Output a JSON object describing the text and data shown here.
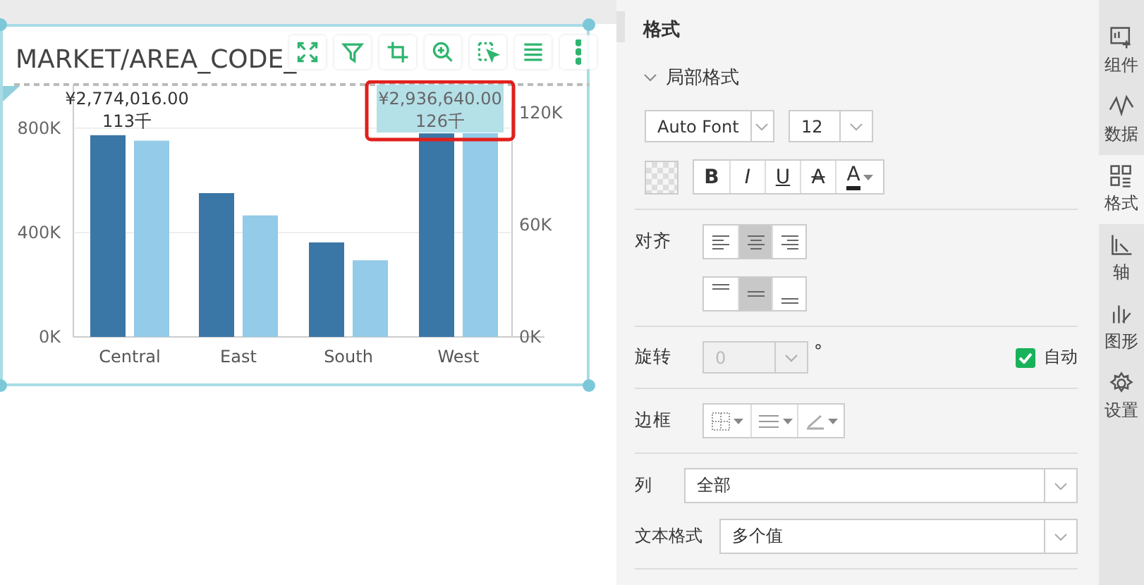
{
  "chart_card": {
    "title": "MARKET/AREA_CODE_",
    "bar_labels": [
      {
        "kind": "first",
        "lines": [
          "¥2,774,016.00",
          "113千"
        ],
        "highlighted": false
      },
      {
        "kind": "last",
        "lines": [
          "¥2,936,640.00",
          "126千"
        ],
        "highlighted": true
      }
    ],
    "chart_data": {
      "type": "bar",
      "stacked": false,
      "categories": [
        "Central",
        "East",
        "South",
        "West"
      ],
      "series": [
        {
          "color": "#3a76a6",
          "values": [
            773000,
            551000,
            362000,
            780000
          ]
        },
        {
          "color": "#93cbe8",
          "axis": "y2",
          "values": [
            105000,
            65000,
            41000,
            109000
          ]
        }
      ],
      "ylim": [
        0,
        967000
      ],
      "y2lim": [
        0,
        135000
      ],
      "yticks": [
        {
          "value": 0,
          "label": "0K"
        },
        {
          "value": 400000,
          "label": "400K"
        },
        {
          "value": 800000,
          "label": "800K"
        }
      ],
      "y2ticks": [
        {
          "value": 0,
          "label": "0K"
        },
        {
          "value": 60000,
          "label": "60K"
        },
        {
          "value": 120000,
          "label": "120K"
        }
      ]
    }
  },
  "panel": {
    "title": "格式",
    "section": {
      "label": "局部格式",
      "expanded": true
    },
    "font": {
      "family": "Auto Font",
      "size": "12"
    },
    "style_buttons": [
      {
        "label": "B",
        "kind": "bold"
      },
      {
        "label": "I",
        "kind": "italic"
      },
      {
        "label": "U",
        "kind": "underline"
      },
      {
        "label": "A",
        "kind": "strike"
      },
      {
        "label": "A",
        "kind": "color"
      }
    ],
    "align": {
      "label": "对齐",
      "horizontal": [
        {
          "kind": "left",
          "selected": false
        },
        {
          "kind": "center",
          "selected": true
        },
        {
          "kind": "right",
          "selected": false
        }
      ],
      "vertical": [
        {
          "kind": "top",
          "selected": false
        },
        {
          "kind": "middle",
          "selected": true
        },
        {
          "kind": "bottom",
          "selected": false
        }
      ]
    },
    "rotate": {
      "label": "旋转",
      "value": "0",
      "disabled": true,
      "unit": "°",
      "auto": {
        "label": "自动",
        "checked": true
      }
    },
    "border": {
      "label": "边框"
    },
    "column": {
      "label": "列",
      "value": "全部"
    },
    "text_format": {
      "label": "文本格式",
      "value": "多个值"
    }
  },
  "side_tabs": [
    {
      "label": "组件",
      "kind": "component",
      "selected": false
    },
    {
      "label": "数据",
      "kind": "data",
      "selected": false
    },
    {
      "label": "格式",
      "kind": "format",
      "selected": true
    },
    {
      "label": "轴",
      "kind": "axis",
      "selected": false
    },
    {
      "label": "图形",
      "kind": "shape",
      "selected": false
    },
    {
      "label": "设置",
      "kind": "settings",
      "selected": false
    }
  ]
}
